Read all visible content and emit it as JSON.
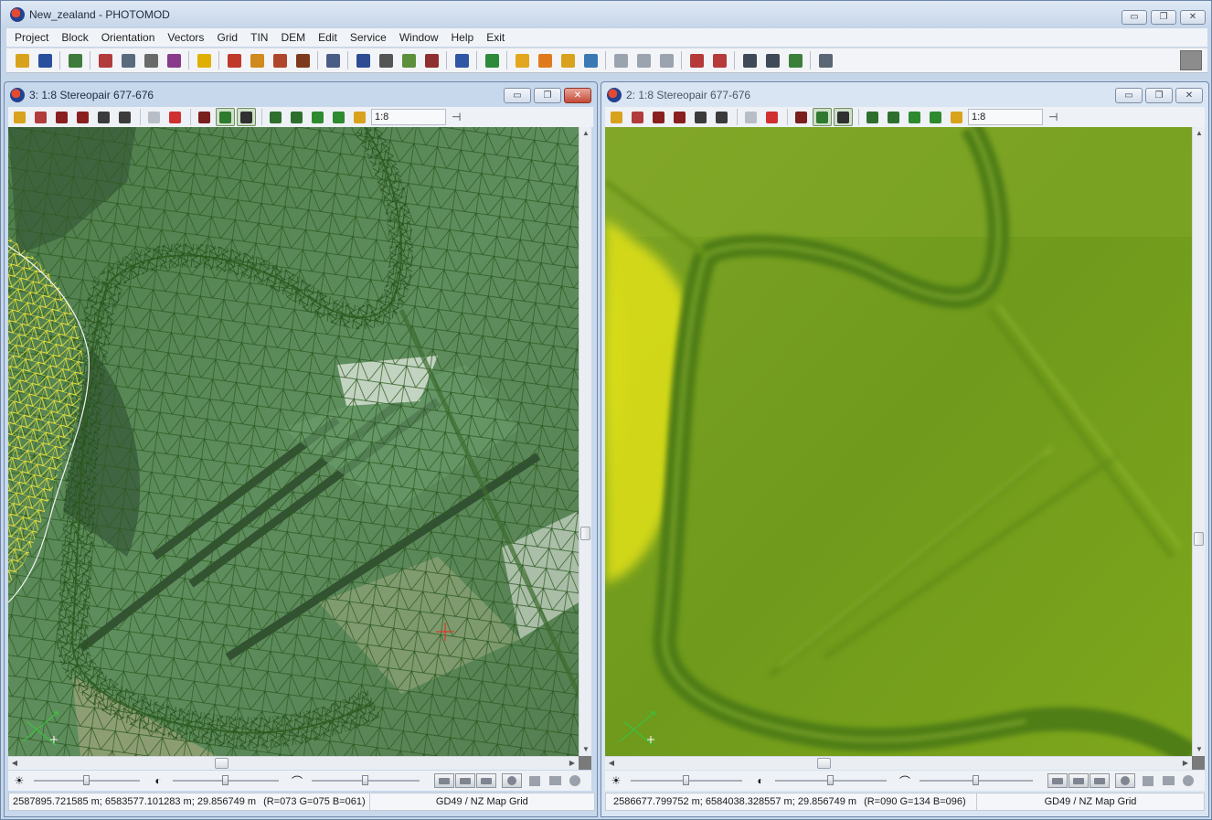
{
  "app": {
    "title": "New_zealand - PHOTOMOD",
    "minimize_glyph": "▭",
    "maximize_glyph": "❐",
    "close_glyph": "✕"
  },
  "menu": [
    "Project",
    "Block",
    "Orientation",
    "Vectors",
    "Grid",
    "TIN",
    "DEM",
    "Edit",
    "Service",
    "Window",
    "Help",
    "Exit"
  ],
  "toolbar": {
    "buttons": [
      {
        "icon": "open-project-icon",
        "color": "#d9a21c"
      },
      {
        "icon": "refresh-icon",
        "color": "#2a4f9c"
      },
      {
        "sep": true
      },
      {
        "icon": "list-icon",
        "color": "#3f7c3b"
      },
      {
        "sep": true
      },
      {
        "icon": "grid-table-icon",
        "color": "#b23b3b"
      },
      {
        "icon": "window-icon",
        "color": "#5a6b7e"
      },
      {
        "icon": "camera-icon",
        "color": "#6a6a6a"
      },
      {
        "icon": "pen-icon",
        "color": "#8a3a8a"
      },
      {
        "sep": true
      },
      {
        "icon": "lightning-icon",
        "color": "#e0b000"
      },
      {
        "sep": true
      },
      {
        "icon": "triangulation-icon",
        "color": "#c0392b"
      },
      {
        "icon": "points-icon",
        "color": "#d08a1e"
      },
      {
        "icon": "matrix-icon",
        "color": "#b0452e"
      },
      {
        "icon": "marker-icon",
        "color": "#7d3b1d"
      },
      {
        "sep": true
      },
      {
        "icon": "network-icon",
        "color": "#4a5d86"
      },
      {
        "sep": true
      },
      {
        "icon": "book-icon",
        "color": "#2e4c93"
      },
      {
        "icon": "tower-icon",
        "color": "#555555"
      },
      {
        "icon": "edit-doc-icon",
        "color": "#5e8f3b"
      },
      {
        "icon": "robot-icon",
        "color": "#8f2f2f"
      },
      {
        "sep": true
      },
      {
        "icon": "house-icon",
        "color": "#2f57a3"
      },
      {
        "sep": true
      },
      {
        "icon": "grid-green-icon",
        "color": "#2d8a3a"
      },
      {
        "sep": true
      },
      {
        "icon": "folder-open-icon",
        "color": "#e2a71d"
      },
      {
        "icon": "folder-star-icon",
        "color": "#e07b1d"
      },
      {
        "icon": "folder-edit-icon",
        "color": "#d9a21c"
      },
      {
        "icon": "globe-icon",
        "color": "#3b79b5"
      },
      {
        "sep": true
      },
      {
        "icon": "undo-icon",
        "color": "#9aa3ae"
      },
      {
        "icon": "page-icon",
        "color": "#9aa3ae"
      },
      {
        "icon": "redo-icon",
        "color": "#9aa3ae"
      },
      {
        "sep": true
      },
      {
        "icon": "counter-100-icon",
        "color": "#b63a3a"
      },
      {
        "icon": "counter-100b-icon",
        "color": "#b63a3a"
      },
      {
        "sep": true
      },
      {
        "icon": "tile-windows-icon",
        "color": "#3f4a58"
      },
      {
        "icon": "cascade-windows-icon",
        "color": "#3f4a58"
      },
      {
        "icon": "sync-icon",
        "color": "#3b7f3b"
      },
      {
        "sep": true
      },
      {
        "icon": "settings-doc-icon",
        "color": "#5b6675"
      }
    ]
  },
  "child_toolbar_buttons": [
    {
      "icon": "marker-add-icon",
      "color": "#d9a21c"
    },
    {
      "icon": "grid-small-icon",
      "color": "#b23b3b"
    },
    {
      "icon": "cursor-target-icon",
      "color": "#8a1f1f"
    },
    {
      "icon": "ruler-icon",
      "color": "#8a1f1f"
    },
    {
      "icon": "stereo-glasses-icon",
      "color": "#3b3b3b"
    },
    {
      "icon": "glasses-icon",
      "color": "#3b3b3b"
    },
    {
      "sep": true
    },
    {
      "icon": "crosshair-icon",
      "color": "#b8bec7"
    },
    {
      "icon": "cross-pair-icon",
      "color": "#d03030"
    },
    {
      "sep": true
    },
    {
      "icon": "contrast-toggle-icon",
      "color": "#7a1e1e"
    },
    {
      "icon": "select-frame-icon",
      "color": "#2f7a2f",
      "pressed": true
    },
    {
      "icon": "corner-frame-icon",
      "color": "#303030",
      "pressed": true
    },
    {
      "sep": true
    },
    {
      "icon": "zoom-in-icon",
      "color": "#2e6f2e"
    },
    {
      "icon": "zoom-out-icon",
      "color": "#2e6f2e"
    },
    {
      "icon": "zoom-fit-icon",
      "color": "#2e8a2e"
    },
    {
      "icon": "zoom-area-icon",
      "color": "#2e8a2e"
    },
    {
      "icon": "zoom-one-icon",
      "color": "#d9a21c"
    }
  ],
  "windows": [
    {
      "id": "left",
      "title": "3: 1:8 Stereopair 677-676",
      "scale": "1:8",
      "coords": "2587895.721585 m; 6583577.101283 m; 29.856749 m",
      "rgb": "(R=073 G=075 B=061)",
      "grid_system": "GD49 / NZ Map Grid",
      "brightness": 0.5,
      "contrast": 0.5,
      "gamma": 0.5
    },
    {
      "id": "right",
      "title": "2: 1:8 Stereopair 677-676",
      "scale": "1:8",
      "coords": "2586677.799752 m; 6584038.328557 m; 29.856749 m",
      "rgb": "(R=090 G=134 B=096)",
      "grid_system": "GD49 / NZ Map Grid",
      "brightness": 0.5,
      "contrast": 0.5,
      "gamma": 0.5
    }
  ],
  "colors": {
    "tin_line": "#2f5a1e",
    "dem_green": "#6f9a1c",
    "dem_yellow": "#f3ee12",
    "footprint_yellow": "#e8e23a"
  }
}
